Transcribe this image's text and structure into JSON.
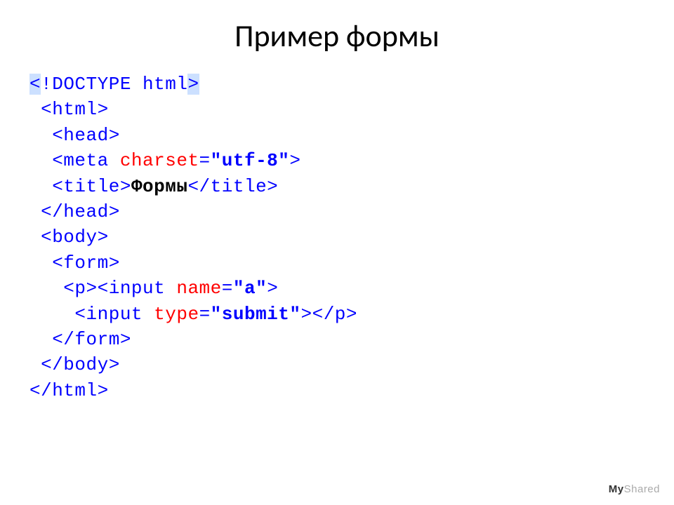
{
  "title": "Пример формы",
  "code": {
    "l1a": "<",
    "l1b": "!",
    "l1c": "DOCTYPE html",
    "l1d": ">",
    "l2": " <html>",
    "l3": "  <head>",
    "l4a": "  <meta ",
    "l4b": "charset",
    "l4c": "=",
    "l4d": "\"utf-8\"",
    "l4e": ">",
    "l5a": "  <title>",
    "l5b": "Формы",
    "l5c": "</title>",
    "l6": " </head>",
    "l7": " <body>",
    "l8": "  <form>",
    "l9a": "   <p><input ",
    "l9b": "name",
    "l9c": "=",
    "l9d": "\"a\"",
    "l9e": ">",
    "l10a": "    <input ",
    "l10b": "type",
    "l10c": "=",
    "l10d": "\"submit\"",
    "l10e": "></p>",
    "l11": "  </form>",
    "l12": " </body>",
    "l13": "</html>"
  },
  "footer": {
    "my": "My",
    "shared": "Shared"
  }
}
